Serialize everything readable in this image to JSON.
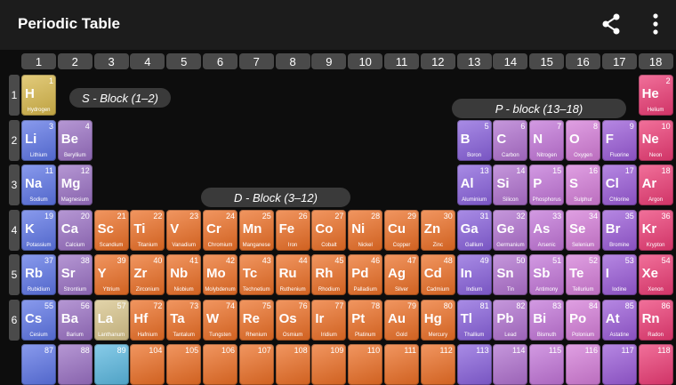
{
  "app_bar": {
    "title": "Periodic Table",
    "share_icon": "share-icon",
    "more_icon": "more-vert-icon"
  },
  "groups": [
    "1",
    "2",
    "3",
    "4",
    "5",
    "6",
    "7",
    "8",
    "9",
    "10",
    "11",
    "12",
    "13",
    "14",
    "15",
    "16",
    "17",
    "18"
  ],
  "periods": [
    "1",
    "2",
    "3",
    "4",
    "5",
    "6"
  ],
  "block_labels": {
    "s": "S - Block (1–2)",
    "p": "P - block (13–18)",
    "d": "D - Block (3–12)"
  },
  "colors": {
    "s1": "#5c74e6",
    "s2": "#9a70c4",
    "d": "#ec6e24",
    "p13": "#8860dc",
    "p14": "#b070cf",
    "p15": "#c274d8",
    "p16": "#d47cd8",
    "p17": "#9a5ad8",
    "p18": "#ec3a74",
    "h": "#d8b84a",
    "la": "#d8c48a",
    "ac": "#5ab8e0"
  },
  "elements": [
    {
      "n": "1",
      "s": "H",
      "name": "Hydrogen",
      "col": 1,
      "row": 1,
      "c": "h"
    },
    {
      "n": "2",
      "s": "He",
      "name": "Helium",
      "col": 18,
      "row": 1,
      "c": "p18"
    },
    {
      "n": "3",
      "s": "Li",
      "name": "Lithium",
      "col": 1,
      "row": 2,
      "c": "s1"
    },
    {
      "n": "4",
      "s": "Be",
      "name": "Beryllium",
      "col": 2,
      "row": 2,
      "c": "s2"
    },
    {
      "n": "5",
      "s": "B",
      "name": "Boron",
      "col": 13,
      "row": 2,
      "c": "p13"
    },
    {
      "n": "6",
      "s": "C",
      "name": "Carbon",
      "col": 14,
      "row": 2,
      "c": "p14"
    },
    {
      "n": "7",
      "s": "N",
      "name": "Nitrogen",
      "col": 15,
      "row": 2,
      "c": "p15"
    },
    {
      "n": "8",
      "s": "O",
      "name": "Oxygen",
      "col": 16,
      "row": 2,
      "c": "p16"
    },
    {
      "n": "9",
      "s": "F",
      "name": "Fluorine",
      "col": 17,
      "row": 2,
      "c": "p17"
    },
    {
      "n": "10",
      "s": "Ne",
      "name": "Neon",
      "col": 18,
      "row": 2,
      "c": "p18"
    },
    {
      "n": "11",
      "s": "Na",
      "name": "Sodium",
      "col": 1,
      "row": 3,
      "c": "s1"
    },
    {
      "n": "12",
      "s": "Mg",
      "name": "Magnesium",
      "col": 2,
      "row": 3,
      "c": "s2"
    },
    {
      "n": "13",
      "s": "Al",
      "name": "Aluminium",
      "col": 13,
      "row": 3,
      "c": "p13"
    },
    {
      "n": "14",
      "s": "Si",
      "name": "Silicon",
      "col": 14,
      "row": 3,
      "c": "p14"
    },
    {
      "n": "15",
      "s": "P",
      "name": "Phosphorus",
      "col": 15,
      "row": 3,
      "c": "p15"
    },
    {
      "n": "16",
      "s": "S",
      "name": "Sulphur",
      "col": 16,
      "row": 3,
      "c": "p16"
    },
    {
      "n": "17",
      "s": "Cl",
      "name": "Chlorine",
      "col": 17,
      "row": 3,
      "c": "p17"
    },
    {
      "n": "18",
      "s": "Ar",
      "name": "Argon",
      "col": 18,
      "row": 3,
      "c": "p18"
    },
    {
      "n": "19",
      "s": "K",
      "name": "Potassium",
      "col": 1,
      "row": 4,
      "c": "s1"
    },
    {
      "n": "20",
      "s": "Ca",
      "name": "Calcium",
      "col": 2,
      "row": 4,
      "c": "s2"
    },
    {
      "n": "21",
      "s": "Sc",
      "name": "Scandium",
      "col": 3,
      "row": 4,
      "c": "d"
    },
    {
      "n": "22",
      "s": "Ti",
      "name": "Titanium",
      "col": 4,
      "row": 4,
      "c": "d"
    },
    {
      "n": "23",
      "s": "V",
      "name": "Vanadium",
      "col": 5,
      "row": 4,
      "c": "d"
    },
    {
      "n": "24",
      "s": "Cr",
      "name": "Chromium",
      "col": 6,
      "row": 4,
      "c": "d"
    },
    {
      "n": "25",
      "s": "Mn",
      "name": "Manganese",
      "col": 7,
      "row": 4,
      "c": "d"
    },
    {
      "n": "26",
      "s": "Fe",
      "name": "Iron",
      "col": 8,
      "row": 4,
      "c": "d"
    },
    {
      "n": "27",
      "s": "Co",
      "name": "Cobalt",
      "col": 9,
      "row": 4,
      "c": "d"
    },
    {
      "n": "28",
      "s": "Ni",
      "name": "Nickel",
      "col": 10,
      "row": 4,
      "c": "d"
    },
    {
      "n": "29",
      "s": "Cu",
      "name": "Copper",
      "col": 11,
      "row": 4,
      "c": "d"
    },
    {
      "n": "30",
      "s": "Zn",
      "name": "Zinc",
      "col": 12,
      "row": 4,
      "c": "d"
    },
    {
      "n": "31",
      "s": "Ga",
      "name": "Gallium",
      "col": 13,
      "row": 4,
      "c": "p13"
    },
    {
      "n": "32",
      "s": "Ge",
      "name": "Germanium",
      "col": 14,
      "row": 4,
      "c": "p14"
    },
    {
      "n": "33",
      "s": "As",
      "name": "Arsenic",
      "col": 15,
      "row": 4,
      "c": "p15"
    },
    {
      "n": "34",
      "s": "Se",
      "name": "Selenium",
      "col": 16,
      "row": 4,
      "c": "p16"
    },
    {
      "n": "35",
      "s": "Br",
      "name": "Bromine",
      "col": 17,
      "row": 4,
      "c": "p17"
    },
    {
      "n": "36",
      "s": "Kr",
      "name": "Krypton",
      "col": 18,
      "row": 4,
      "c": "p18"
    },
    {
      "n": "37",
      "s": "Rb",
      "name": "Rubidium",
      "col": 1,
      "row": 5,
      "c": "s1"
    },
    {
      "n": "38",
      "s": "Sr",
      "name": "Strontium",
      "col": 2,
      "row": 5,
      "c": "s2"
    },
    {
      "n": "39",
      "s": "Y",
      "name": "Yttrium",
      "col": 3,
      "row": 5,
      "c": "d"
    },
    {
      "n": "40",
      "s": "Zr",
      "name": "Zirconium",
      "col": 4,
      "row": 5,
      "c": "d"
    },
    {
      "n": "41",
      "s": "Nb",
      "name": "Niobium",
      "col": 5,
      "row": 5,
      "c": "d"
    },
    {
      "n": "42",
      "s": "Mo",
      "name": "Molybdenum",
      "col": 6,
      "row": 5,
      "c": "d"
    },
    {
      "n": "43",
      "s": "Tc",
      "name": "Technetium",
      "col": 7,
      "row": 5,
      "c": "d"
    },
    {
      "n": "44",
      "s": "Ru",
      "name": "Ruthenium",
      "col": 8,
      "row": 5,
      "c": "d"
    },
    {
      "n": "45",
      "s": "Rh",
      "name": "Rhodium",
      "col": 9,
      "row": 5,
      "c": "d"
    },
    {
      "n": "46",
      "s": "Pd",
      "name": "Palladium",
      "col": 10,
      "row": 5,
      "c": "d"
    },
    {
      "n": "47",
      "s": "Ag",
      "name": "Silver",
      "col": 11,
      "row": 5,
      "c": "d"
    },
    {
      "n": "48",
      "s": "Cd",
      "name": "Cadmium",
      "col": 12,
      "row": 5,
      "c": "d"
    },
    {
      "n": "49",
      "s": "In",
      "name": "Indium",
      "col": 13,
      "row": 5,
      "c": "p13"
    },
    {
      "n": "50",
      "s": "Sn",
      "name": "Tin",
      "col": 14,
      "row": 5,
      "c": "p14"
    },
    {
      "n": "51",
      "s": "Sb",
      "name": "Antimony",
      "col": 15,
      "row": 5,
      "c": "p15"
    },
    {
      "n": "52",
      "s": "Te",
      "name": "Tellurium",
      "col": 16,
      "row": 5,
      "c": "p16"
    },
    {
      "n": "53",
      "s": "I",
      "name": "Iodine",
      "col": 17,
      "row": 5,
      "c": "p17"
    },
    {
      "n": "54",
      "s": "Xe",
      "name": "Xenon",
      "col": 18,
      "row": 5,
      "c": "p18"
    },
    {
      "n": "55",
      "s": "Cs",
      "name": "Cesium",
      "col": 1,
      "row": 6,
      "c": "s1"
    },
    {
      "n": "56",
      "s": "Ba",
      "name": "Barium",
      "col": 2,
      "row": 6,
      "c": "s2"
    },
    {
      "n": "57",
      "s": "La",
      "name": "Lanthanum",
      "col": 3,
      "row": 6,
      "c": "la"
    },
    {
      "n": "72",
      "s": "Hf",
      "name": "Hafnium",
      "col": 4,
      "row": 6,
      "c": "d"
    },
    {
      "n": "73",
      "s": "Ta",
      "name": "Tantalum",
      "col": 5,
      "row": 6,
      "c": "d"
    },
    {
      "n": "74",
      "s": "W",
      "name": "Tungsten",
      "col": 6,
      "row": 6,
      "c": "d"
    },
    {
      "n": "75",
      "s": "Re",
      "name": "Rhenium",
      "col": 7,
      "row": 6,
      "c": "d"
    },
    {
      "n": "76",
      "s": "Os",
      "name": "Osmium",
      "col": 8,
      "row": 6,
      "c": "d"
    },
    {
      "n": "77",
      "s": "Ir",
      "name": "Iridium",
      "col": 9,
      "row": 6,
      "c": "d"
    },
    {
      "n": "78",
      "s": "Pt",
      "name": "Platinum",
      "col": 10,
      "row": 6,
      "c": "d"
    },
    {
      "n": "79",
      "s": "Au",
      "name": "Gold",
      "col": 11,
      "row": 6,
      "c": "d"
    },
    {
      "n": "80",
      "s": "Hg",
      "name": "Mercury",
      "col": 12,
      "row": 6,
      "c": "d"
    },
    {
      "n": "81",
      "s": "Tl",
      "name": "Thallium",
      "col": 13,
      "row": 6,
      "c": "p13"
    },
    {
      "n": "82",
      "s": "Pb",
      "name": "Lead",
      "col": 14,
      "row": 6,
      "c": "p14"
    },
    {
      "n": "83",
      "s": "Bi",
      "name": "Bismuth",
      "col": 15,
      "row": 6,
      "c": "p15"
    },
    {
      "n": "84",
      "s": "Po",
      "name": "Polonium",
      "col": 16,
      "row": 6,
      "c": "p16"
    },
    {
      "n": "85",
      "s": "At",
      "name": "Astatine",
      "col": 17,
      "row": 6,
      "c": "p17"
    },
    {
      "n": "86",
      "s": "Rn",
      "name": "Radon",
      "col": 18,
      "row": 6,
      "c": "p18"
    },
    {
      "n": "87",
      "s": "",
      "name": "",
      "col": 1,
      "row": 7,
      "c": "s1"
    },
    {
      "n": "88",
      "s": "",
      "name": "",
      "col": 2,
      "row": 7,
      "c": "s2"
    },
    {
      "n": "89",
      "s": "",
      "name": "",
      "col": 3,
      "row": 7,
      "c": "ac"
    },
    {
      "n": "104",
      "s": "",
      "name": "",
      "col": 4,
      "row": 7,
      "c": "d"
    },
    {
      "n": "105",
      "s": "",
      "name": "",
      "col": 5,
      "row": 7,
      "c": "d"
    },
    {
      "n": "106",
      "s": "",
      "name": "",
      "col": 6,
      "row": 7,
      "c": "d"
    },
    {
      "n": "107",
      "s": "",
      "name": "",
      "col": 7,
      "row": 7,
      "c": "d"
    },
    {
      "n": "108",
      "s": "",
      "name": "",
      "col": 8,
      "row": 7,
      "c": "d"
    },
    {
      "n": "109",
      "s": "",
      "name": "",
      "col": 9,
      "row": 7,
      "c": "d"
    },
    {
      "n": "110",
      "s": "",
      "name": "",
      "col": 10,
      "row": 7,
      "c": "d"
    },
    {
      "n": "111",
      "s": "",
      "name": "",
      "col": 11,
      "row": 7,
      "c": "d"
    },
    {
      "n": "112",
      "s": "",
      "name": "",
      "col": 12,
      "row": 7,
      "c": "d"
    },
    {
      "n": "113",
      "s": "",
      "name": "",
      "col": 13,
      "row": 7,
      "c": "p13"
    },
    {
      "n": "114",
      "s": "",
      "name": "",
      "col": 14,
      "row": 7,
      "c": "p14"
    },
    {
      "n": "115",
      "s": "",
      "name": "",
      "col": 15,
      "row": 7,
      "c": "p15"
    },
    {
      "n": "116",
      "s": "",
      "name": "",
      "col": 16,
      "row": 7,
      "c": "p16"
    },
    {
      "n": "117",
      "s": "",
      "name": "",
      "col": 17,
      "row": 7,
      "c": "p17"
    },
    {
      "n": "118",
      "s": "",
      "name": "",
      "col": 18,
      "row": 7,
      "c": "p18"
    }
  ]
}
